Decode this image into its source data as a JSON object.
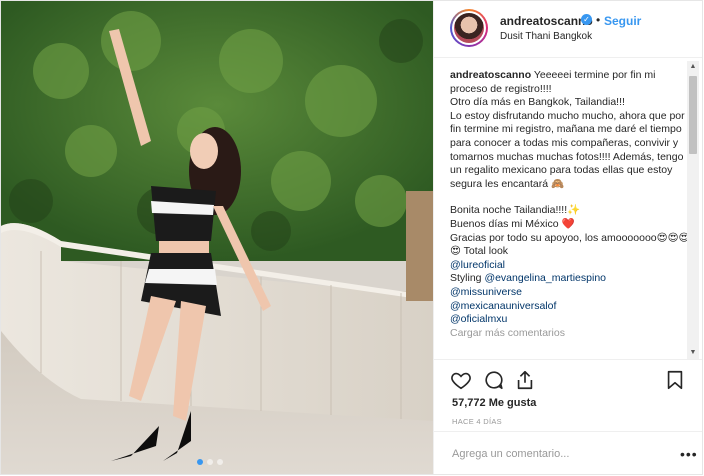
{
  "post": {
    "username": "andreatoscanno",
    "separator": "•",
    "follow_label": "Seguir",
    "location": "Dusit Thani Bangkok",
    "caption": {
      "username": "andreatoscanno",
      "paragraph1": " Yeeeeei termine por fin mi proceso de registro!!!!\nOtro día más en Bangkok, Tailandia!!!\nLo estoy disfrutando mucho mucho, ahora que por fin termine mi registro, mañana me daré el tiempo para conocer a todas mis compañeras, convivir y tomarnos muchas muchas fotos!!!! Además, tengo un regalito mexicano para todas ellas que estoy segura les encantará 🙈",
      "paragraph2": "Bonita noche Tailandia!!!!✨\nBuenos días mi México ❤️\nGracias por todo su apoyoo, los amooooooo😍😍😍😍 Total look",
      "mentions": [
        "@lureoficial",
        "@missuniverse",
        "@mexicanauniversalof",
        "@oficialmxu"
      ],
      "styling_label": "Styling ",
      "styling_mention": "@evangelina_martiespino",
      "more_comments": "Cargar más comentarios"
    },
    "likes": "57,772 Me gusta",
    "time_ago": "HACE 4 DÍAS",
    "comment_placeholder": "Agrega un comentario...",
    "menu_glyph": "•••"
  },
  "icons": {
    "heart": "heart-icon",
    "comment": "comment-icon",
    "share": "share-icon",
    "bookmark": "bookmark-icon",
    "verified": "verified-badge-icon"
  },
  "colors": {
    "link_blue": "#3897f0",
    "mention_blue": "#003569",
    "muted": "#999999"
  }
}
